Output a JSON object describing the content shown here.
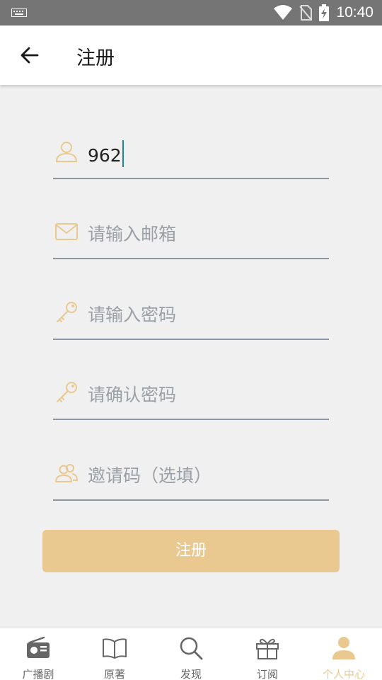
{
  "status_bar": {
    "time": "10:40"
  },
  "header": {
    "title": "注册"
  },
  "form": {
    "username_value": "962",
    "email_placeholder": "请输入邮箱",
    "password_placeholder": "请输入密码",
    "confirm_placeholder": "请确认密码",
    "invite_placeholder": "邀请码（选填）",
    "submit_label": "注册"
  },
  "bottom_nav": {
    "items": [
      {
        "label": "广播剧",
        "icon": "radio-icon"
      },
      {
        "label": "原著",
        "icon": "book-icon"
      },
      {
        "label": "发现",
        "icon": "search-icon"
      },
      {
        "label": "订阅",
        "icon": "gift-icon"
      },
      {
        "label": "个人中心",
        "icon": "person-icon"
      }
    ],
    "active_index": 4
  },
  "colors": {
    "accent": "#e9c98f",
    "status_bar": "#757575",
    "field_line": "#8d96a3",
    "placeholder": "#9aa0a6",
    "cursor": "#1a8a8a"
  }
}
